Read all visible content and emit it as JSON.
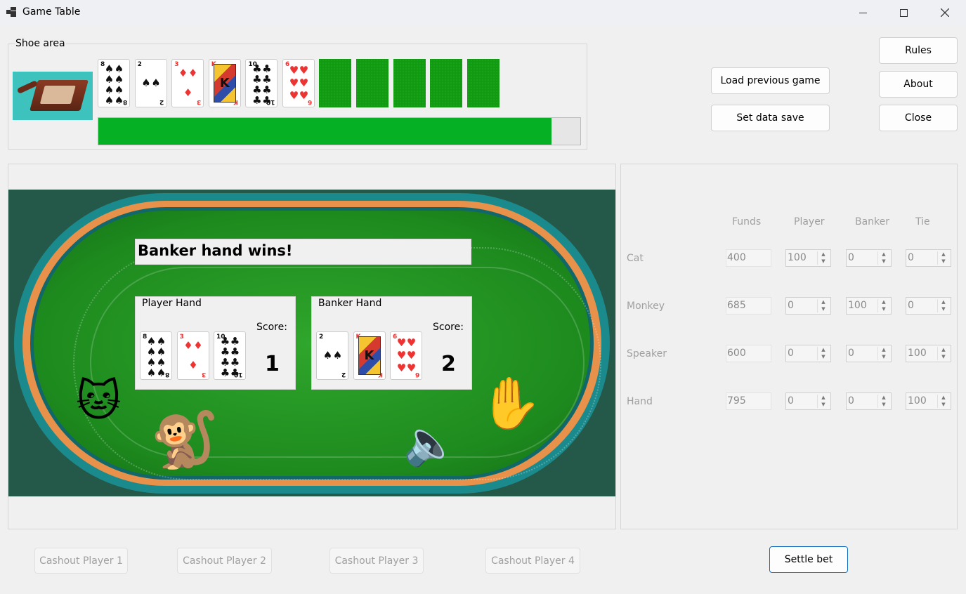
{
  "window": {
    "title": "Game Table"
  },
  "shoe": {
    "label": "Shoe area",
    "progress_fraction": 0.94,
    "dealt_cards": [
      {
        "rank": "8",
        "suit": "♠",
        "color": "black",
        "pips": 8
      },
      {
        "rank": "2",
        "suit": "♠",
        "color": "black",
        "pips": 2
      },
      {
        "rank": "3",
        "suit": "♦",
        "color": "red",
        "pips": 3
      },
      {
        "rank": "K",
        "suit": "♦",
        "color": "red",
        "pips": 0
      },
      {
        "rank": "10",
        "suit": "♣",
        "color": "black",
        "pips": 10
      },
      {
        "rank": "6",
        "suit": "♥",
        "color": "red",
        "pips": 6
      }
    ]
  },
  "buttons": {
    "load_previous": "Load previous game",
    "set_data_save": "Set data save",
    "rules": "Rules",
    "about": "About",
    "close": "Close",
    "settle_bet": "Settle bet",
    "cashout": [
      "Cashout Player 1",
      "Cashout Player 2",
      "Cashout Player 3",
      "Cashout Player 4"
    ]
  },
  "table": {
    "result": "Banker hand wins!",
    "player_hand": {
      "label": "Player Hand",
      "score_label": "Score:",
      "score": "1",
      "cards": [
        {
          "rank": "8",
          "suit": "♠",
          "color": "black",
          "pips": 8
        },
        {
          "rank": "3",
          "suit": "♦",
          "color": "red",
          "pips": 3
        },
        {
          "rank": "10",
          "suit": "♣",
          "color": "black",
          "pips": 10
        }
      ]
    },
    "banker_hand": {
      "label": "Banker Hand",
      "score_label": "Score:",
      "score": "2",
      "cards": [
        {
          "rank": "2",
          "suit": "♠",
          "color": "black",
          "pips": 2
        },
        {
          "rank": "K",
          "suit": "♦",
          "color": "red",
          "pips": 0
        },
        {
          "rank": "6",
          "suit": "♥",
          "color": "red",
          "pips": 6
        }
      ]
    },
    "avatars": [
      "cat-face",
      "monkey",
      "speaker",
      "raised-hand"
    ]
  },
  "bets": {
    "headers": {
      "funds": "Funds",
      "player": "Player",
      "banker": "Banker",
      "tie": "Tie"
    },
    "rows": [
      {
        "name": "Cat",
        "funds": "400",
        "player": "100",
        "banker": "0",
        "tie": "0"
      },
      {
        "name": "Monkey",
        "funds": "685",
        "player": "0",
        "banker": "100",
        "tie": "0"
      },
      {
        "name": "Speaker",
        "funds": "600",
        "player": "0",
        "banker": "0",
        "tie": "100"
      },
      {
        "name": "Hand",
        "funds": "795",
        "player": "0",
        "banker": "0",
        "tie": "100"
      }
    ]
  }
}
